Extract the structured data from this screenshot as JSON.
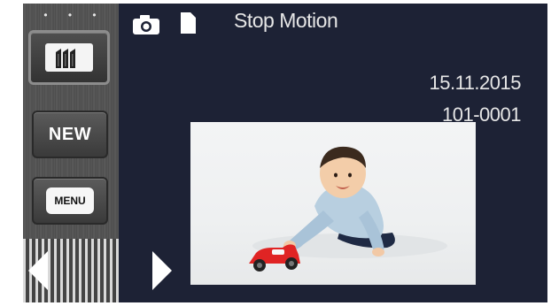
{
  "header": {
    "mode_title": "Stop Motion",
    "icons": [
      "camera-icon",
      "sd-card-icon"
    ]
  },
  "sidebar": {
    "indicator": "• • •",
    "playback_button": {
      "icon": "playback-tiles-icon",
      "selected": true
    },
    "new_button": {
      "label": "NEW"
    },
    "menu_button": {
      "label": "MENU"
    },
    "nav": {
      "prev_icon": "triangle-left-icon",
      "next_icon": "triangle-right-icon"
    }
  },
  "info": {
    "date": "15.11.2015",
    "file_number": "101-0001"
  },
  "colors": {
    "screen_bg": "#1d2235",
    "text": "#e6e6e6",
    "sidebar": "#4e4e4e"
  }
}
